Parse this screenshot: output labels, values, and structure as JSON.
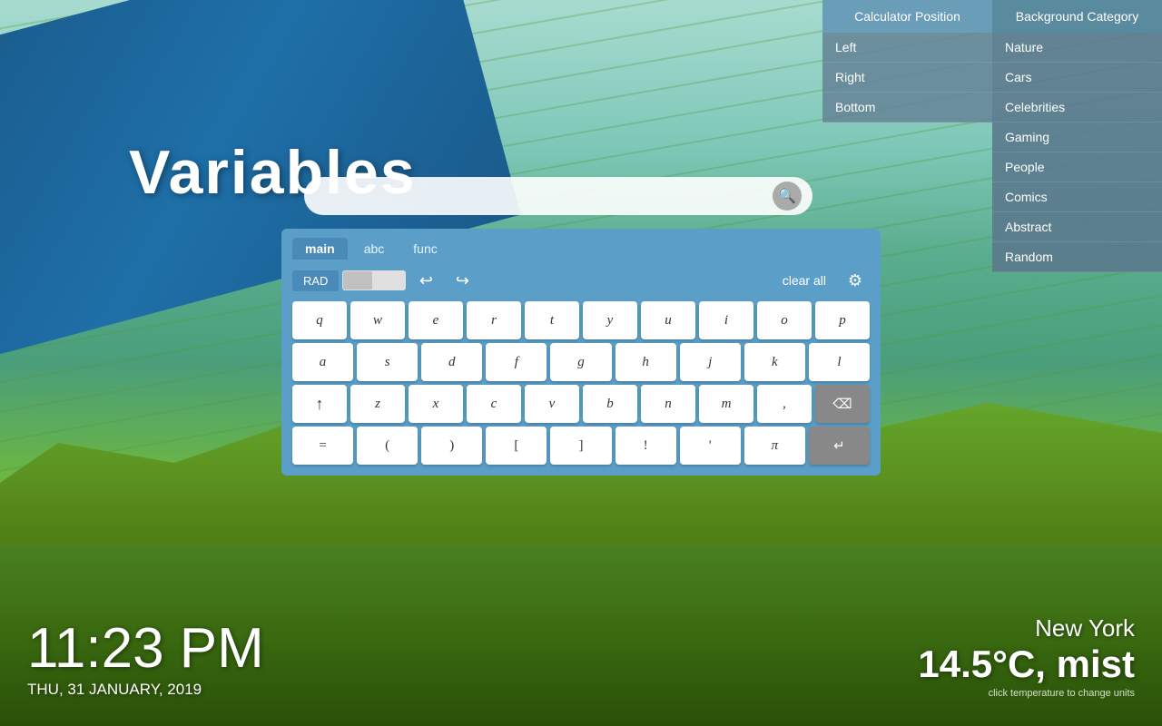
{
  "background": {
    "sky_color": "#a8dbd0",
    "ground_color": "#6ab545"
  },
  "banner": {
    "text": "Variables"
  },
  "search": {
    "placeholder": "",
    "button_icon": "🔍"
  },
  "calculator": {
    "tabs": [
      {
        "label": "main",
        "active": true
      },
      {
        "label": "abc",
        "active": false
      },
      {
        "label": "func",
        "active": false
      }
    ],
    "mode_button": "RAD",
    "undo_icon": "↩",
    "redo_icon": "↪",
    "clear_label": "clear all",
    "settings_icon": "⚙",
    "rows": [
      [
        "q",
        "w",
        "e",
        "r",
        "t",
        "y",
        "u",
        "i",
        "o",
        "p"
      ],
      [
        "a",
        "s",
        "d",
        "f",
        "g",
        "h",
        "j",
        "k",
        "l"
      ],
      [
        "↑",
        "z",
        "x",
        "c",
        "v",
        "b",
        "n",
        "m",
        ",",
        "⌫"
      ],
      [
        "=",
        "(",
        ")",
        "[",
        "]",
        "!",
        "'",
        "π",
        "↵"
      ]
    ]
  },
  "dropdown": {
    "position_header": "Calculator Position",
    "position_items": [
      "Left",
      "Right",
      "Bottom"
    ],
    "category_header": "Background Category",
    "category_items": [
      "Nature",
      "Cars",
      "Celebrities",
      "Gaming",
      "People",
      "Comics",
      "Abstract",
      "Random"
    ]
  },
  "clock": {
    "time": "11:23 PM",
    "date": "THU, 31 JANUARY, 2019"
  },
  "weather": {
    "city": "New York",
    "temp": "14.5°C, mist",
    "click_hint": "click temperature to change units"
  }
}
